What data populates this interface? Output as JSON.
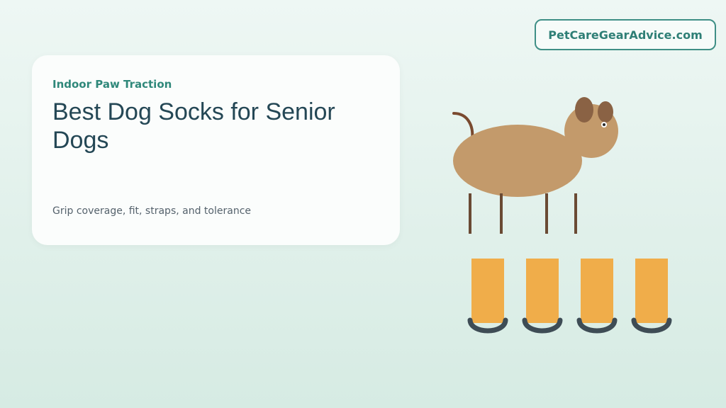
{
  "site": {
    "badge": "PetCareGearAdvice.com"
  },
  "card": {
    "eyebrow": "Indoor Paw Traction",
    "title": "Best Dog Socks for Senior Dogs",
    "subtitle": "Grip coverage, fit, straps, and tolerance"
  },
  "illustration": {
    "icon": "dog-with-socks-illustration",
    "colors": {
      "dog_body": "#C39A6B",
      "dog_ear": "#8A6244",
      "dog_tail": "#7A4A2F",
      "dog_leg": "#6A4A34",
      "sock": "#F0AD4A",
      "sock_grip": "#3E4C55",
      "eye_white": "#FFFFFF",
      "eye_pupil": "#2A2A2A"
    },
    "sock_count": 4
  }
}
